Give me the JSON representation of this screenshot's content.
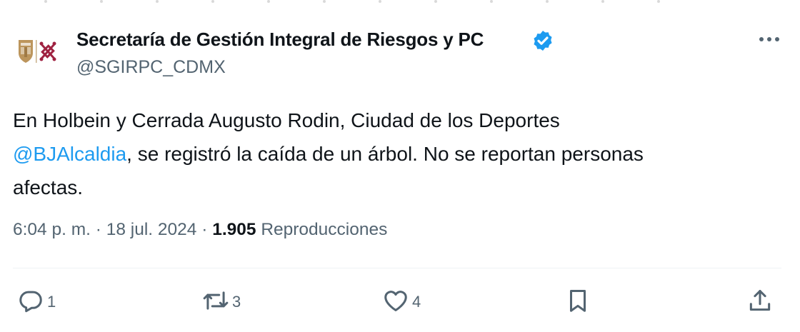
{
  "author": {
    "name": "Secretaría de Gestión Integral de Riesgos y PC",
    "handle": "@SGIRPC_CDMX"
  },
  "tweet": {
    "text_line1": "En Holbein y Cerrada Augusto Rodin, Ciudad de los Deportes",
    "mention": "@BJAlcaldia",
    "text_after_mention": ", se registró la caída de un árbol. No se reportan personas",
    "text_line3": "afectas."
  },
  "meta": {
    "time": "6:04 p. m.",
    "separator1": " · ",
    "date": "18 jul. 2024",
    "separator2": " · ",
    "views_count": "1.905",
    "views_label": "Reproducciones"
  },
  "actions": {
    "replies": "1",
    "retweets": "3",
    "likes": "4"
  },
  "icons": {
    "verified": "verified-badge-icon",
    "more": "more-options-icon",
    "reply": "reply-icon",
    "retweet": "retweet-icon",
    "like": "heart-icon",
    "bookmark": "bookmark-icon",
    "share": "share-icon"
  },
  "colors": {
    "text": "#0f1419",
    "secondary": "#536471",
    "link": "#1d9bf0",
    "verified": "#1d9bf0",
    "logo_maroon": "#9f2241",
    "logo_gold": "#bc955c"
  }
}
